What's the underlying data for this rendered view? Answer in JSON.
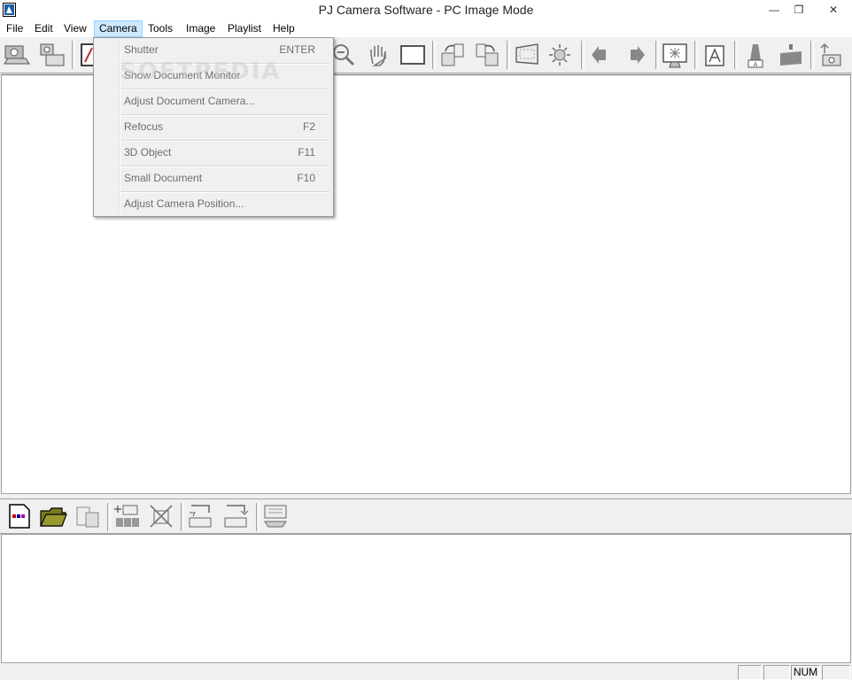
{
  "window": {
    "title": "PJ Camera Software - PC Image Mode",
    "minimize": "—",
    "restore": "❒",
    "close": "✕"
  },
  "menubar": {
    "items": [
      "File",
      "Edit",
      "View",
      "Camera",
      "Tools",
      "Image",
      "Playlist",
      "Help"
    ],
    "active": "Camera"
  },
  "camera_menu": {
    "items": [
      {
        "label": "Shutter",
        "shortcut": "ENTER"
      },
      {
        "label": "Show Document Monitor",
        "shortcut": ""
      },
      {
        "label": "Adjust Document Camera...",
        "shortcut": ""
      },
      {
        "label": "Refocus",
        "shortcut": "F2"
      },
      {
        "label": "3D Object",
        "shortcut": "F11"
      },
      {
        "label": "Small Document",
        "shortcut": "F10"
      },
      {
        "label": "Adjust Camera Position...",
        "shortcut": ""
      }
    ]
  },
  "watermark": "SOFTPEDIA",
  "statusbar": {
    "num": "NUM"
  },
  "colors": {
    "menu_highlight": "#cce8ff",
    "disabled_text": "#6d6d6d",
    "folder_yellow": "#7c7a1e",
    "icon_gray": "#808080"
  }
}
